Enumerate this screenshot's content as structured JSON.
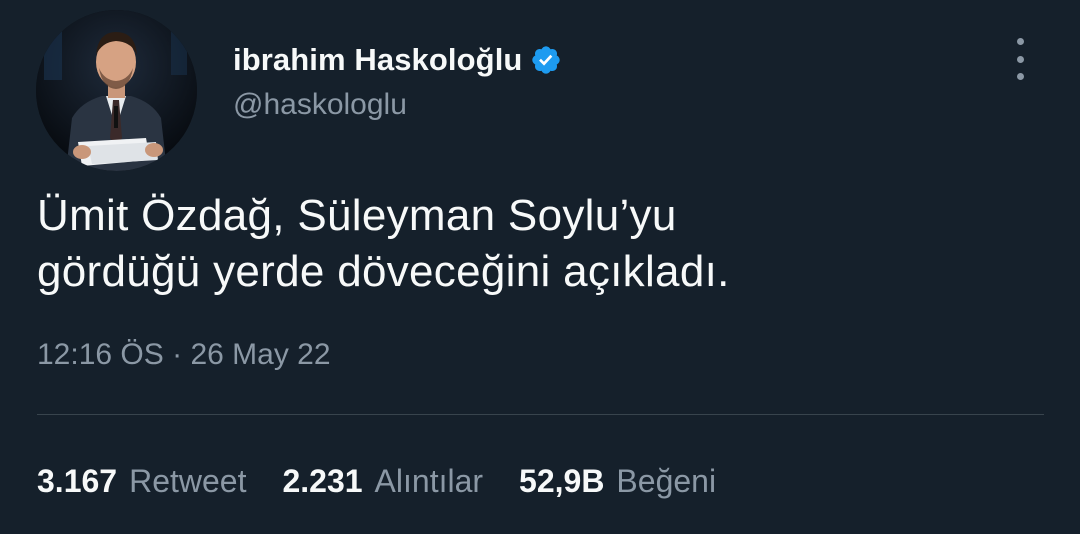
{
  "author": {
    "display_name": "ibrahim Haskoloğlu",
    "handle": "@haskologlu",
    "verified": true,
    "avatar_icon": "profile-photo-man-in-suit"
  },
  "menu": {
    "icon": "more-vertical-icon"
  },
  "tweet": {
    "text_lines": [
      "Ümit Özdağ, Süleyman Soylu’yu",
      "gördüğü yerde döveceğini açıkladı."
    ],
    "time": "12:16 ÖS",
    "separator": "·",
    "date": "26 May 22"
  },
  "stats": {
    "retweets": {
      "count": "3.167",
      "label": "Retweet"
    },
    "quotes": {
      "count": "2.231",
      "label": "Alıntılar"
    },
    "likes": {
      "count": "52,9B",
      "label": "Beğeni"
    }
  },
  "colors": {
    "background": "#15202b",
    "text_primary": "#f7f9f9",
    "text_secondary": "#8b98a5",
    "divider": "#38444d",
    "verified_badge": "#1d9bf0"
  }
}
